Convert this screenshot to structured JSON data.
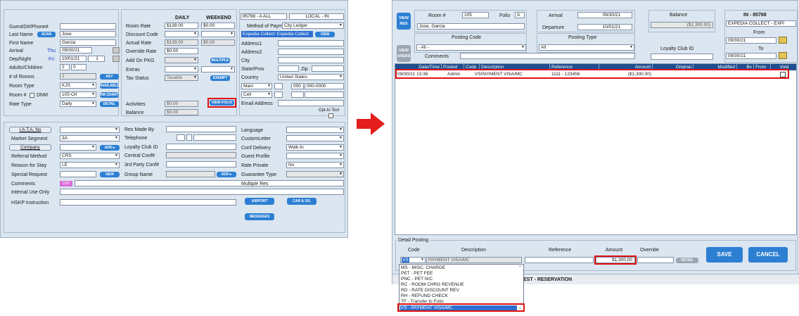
{
  "left_form": {
    "col1": {
      "guest_id_label": "GuestID#/Phone#",
      "last_name_label": "Last Name",
      "scan_button": "SCAN",
      "last_name_value": "Jose",
      "first_name_label": "First Name",
      "first_name_value": "Garcia",
      "arrival_label": "Arrival",
      "arrival_day": "Thu",
      "arrival_value": "09/30/21",
      "dep_label": "Dep/Night",
      "dep_day": "Fri",
      "dep_value": "10/01/21",
      "nights_value": "1",
      "adults_label": "Adults/Children",
      "adults_value": "2",
      "children_value": "0",
      "rooms_label": "# of Rooms",
      "rooms_value": "1",
      "key_button": "KEY",
      "room_type_label": "Room Type",
      "room_type_value": "KJS",
      "available_button": "AVAILABLE",
      "room_no_label": "Room #",
      "dnm_label": "DNM",
      "room_no_value": "105-O/I",
      "rm_chart_button": "RM CHART",
      "rate_type_label": "Rate Type",
      "rate_type_value": "Daily",
      "detail_button": "DETAIL"
    },
    "col2": {
      "daily_header": "DAILY",
      "weekend_header": "WEEKEND",
      "room_rate_label": "Room Rate",
      "room_rate_daily": "$139.00",
      "room_rate_weekend": "$0.00",
      "discount_label": "Discount Code",
      "actual_rate_label": "Actual Rate",
      "actual_rate_daily": "$139.00",
      "actual_rate_weekend": "$0.00",
      "override_label": "Override Rate",
      "override_value": "$0.00",
      "addon_label": "Add On PKG",
      "multiple_button": "MULTIPLE",
      "extras_label": "Extras",
      "tax_label": "Tax Status",
      "tax_value": "Taxable",
      "exempt_button": "EXEMPT",
      "activities_label": "Activities",
      "activities_value": "$0.00",
      "view_folio_button": "VIEW FOLIO",
      "balance_label": "Balance",
      "balance_value": "$0.00"
    },
    "col3": {
      "res_code": "85768 - A  ALL",
      "local_status": "LOCAL - IN",
      "method_label": "Method of Payment",
      "method_value": "City Ledger",
      "expedia_value": "Expedia Collect: Expedia Collect",
      "view_button": "VIEW",
      "address1_label": "Address1",
      "address2_label": "Address2",
      "city_label": "City",
      "state_label": "State/Prov",
      "zip_label": "Zip",
      "country_label": "Country",
      "country_value": "United States",
      "main_label": "Main",
      "phone_area": "000",
      "phone_number": "000-0000",
      "cell_label": "Cell",
      "email_label": "Email Address",
      "opt_in_label": "Opt-In Text"
    },
    "lower": {
      "iata_button": "I.A.T.A. No",
      "market_label": "Market Segment",
      "market_value": "3A",
      "company_button": "Company",
      "add_button": "ADD ▸",
      "referral_label": "Referral Method",
      "referral_value": "CRS",
      "reason_label": "Reason for Stay",
      "reason_value": "LE",
      "special_label": "Special Request",
      "new_button": "NEW",
      "comments_label": "Comments",
      "crs_tag": "CRS",
      "internal_label": "Internal Use Only",
      "hskp_label": "HSKP Instruction",
      "res_made_label": "Res Made By",
      "telephone_label": "Telephone",
      "loyalty_label": "Loyalty Club ID",
      "central_label": "Central Conf#",
      "third_party_label": "3rd Party Conf#",
      "group_label": "Group Name",
      "add2_button": "ADD ▸",
      "language_label": "Language",
      "custom_letter_label": "CustomLetter",
      "conf_delivery_label": "Conf Delivery",
      "conf_delivery_value": "Walk-In",
      "guest_profile_label": "Guest Profile",
      "rate_private_label": "Rate Private",
      "rate_private_value": "No",
      "guarantee_label": "Guarantee Type",
      "multiple_res_label": "Multiple Res",
      "airport_button": "AIRPORT",
      "car_button": "CAR & O/L",
      "messages_button": "MESSAGES"
    }
  },
  "arrow": {
    "color": "#e41d1d"
  },
  "folio": {
    "view_res_button": "VIEW\nRES",
    "view_afers_button": "VIEW\nAFERS",
    "room_label": "Room #",
    "room_value": "105",
    "folio_label": "Folio",
    "folio_value": "A",
    "guest_name": "Jose, Garcia",
    "arrival_label": "Arrival",
    "arrival_value": "09/30/21",
    "departure_label": "Departure",
    "departure_value": "10/01/21",
    "balance_label": "Balance",
    "balance_value": "($1,300.00)",
    "res_code": "IN - 85768",
    "res_payment": "EXPEDIA COLLECT - EXPI",
    "from_label": "From",
    "from_value": "09/30/21",
    "to_label": "To",
    "to_value": "09/30/21",
    "posting_code_label": "Posting Code",
    "posting_code_value": "- All -",
    "posting_type_label": "Posting Type",
    "posting_type_value": "All",
    "loyalty_label": "Loyalty Club ID",
    "comments_label": "Comments",
    "columns": [
      "Date/Time",
      "Posted",
      "Code",
      "Description",
      "Reference",
      "Amount",
      "Original",
      "Modified",
      "Bv",
      "From",
      "Void"
    ],
    "rows": [
      {
        "datetime": "09/30/21 13:36",
        "posted": "Admin",
        "code": "VS",
        "description": "PAYMENT VISA/MC",
        "reference": "1111 - 123456",
        "amount": "($1,300.00)"
      }
    ],
    "detail": {
      "title": "Detail Posting",
      "code_header": "Code",
      "desc_header": "Description",
      "ref_header": "Reference",
      "amount_header": "Amount",
      "override_header": "Override",
      "code_value": "VS",
      "desc_value": "PAYMENT VISA/MC",
      "amount_value": "$1,300.00",
      "detail_button": "DETAIL",
      "save_button": "SAVE",
      "cancel_button": "CANCEL",
      "status_text": "EST - RESERVATION"
    },
    "dropdown_items": [
      "MS  - MISC. CHARGE",
      "PET  - PET FEE",
      "PNC  - PET N/C",
      "RC  - ROOM CHRG REVENUE",
      "RD  - RATE DISCOUNT REV",
      "RH  - REFUND CHECK",
      "TF  - Transfer to Folio",
      "VS  - PAYMENT VISA/MC"
    ]
  }
}
